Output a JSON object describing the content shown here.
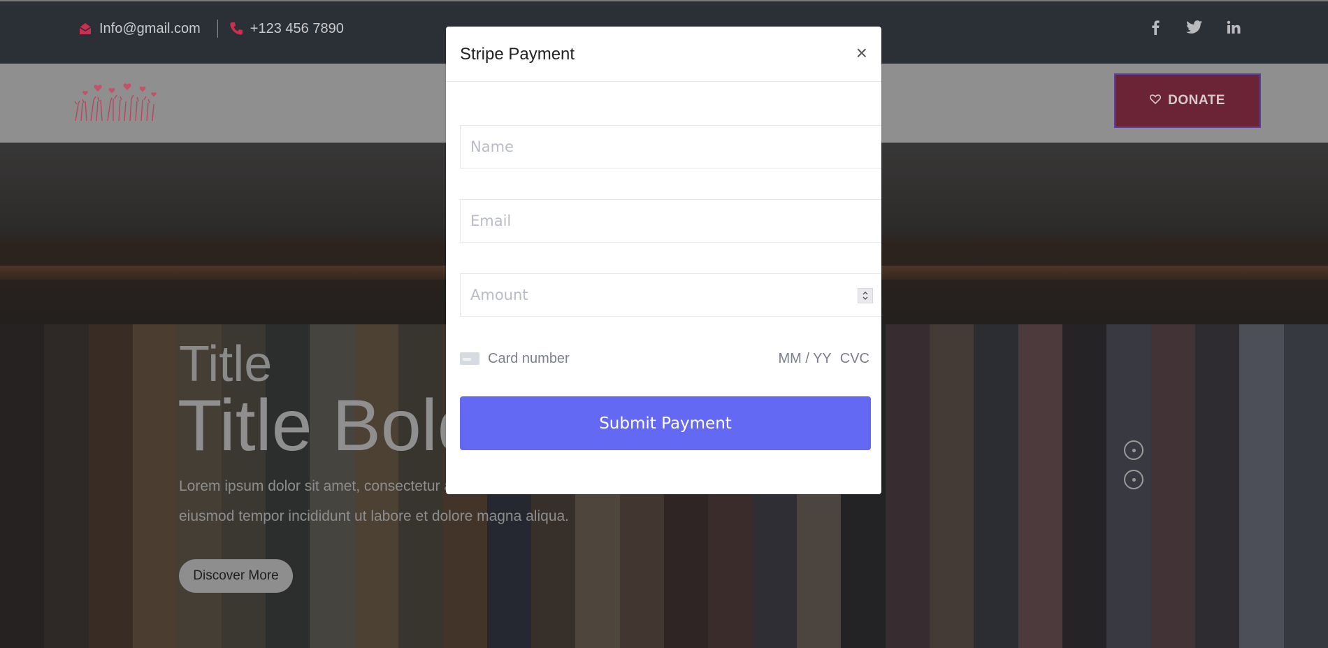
{
  "topbar": {
    "email": "Info@gmail.com",
    "phone": "+123 456 7890",
    "social": [
      "facebook-icon",
      "twitter-icon",
      "linkedin-icon"
    ]
  },
  "header": {
    "donate_label": "DONATE"
  },
  "hero": {
    "title": "Title",
    "title_bold": "Title Bold",
    "lorem": "Lorem ipsum dolor sit amet, consectetur adipiscing elit, sed do eiusmod tempor incididunt ut labore et dolore magna aliqua.",
    "discover_label": "Discover More"
  },
  "modal": {
    "title": "Stripe Payment",
    "close_glyph": "×",
    "name_placeholder": "Name",
    "email_placeholder": "Email",
    "amount_placeholder": "Amount",
    "card_number_placeholder": "Card number",
    "expiry_placeholder": "MM / YY",
    "cvc_placeholder": "CVC",
    "submit_label": "Submit Payment"
  },
  "colors": {
    "accent": "#6469f4",
    "brand_red": "#c92f4f",
    "donate_bg": "#6b2436"
  }
}
